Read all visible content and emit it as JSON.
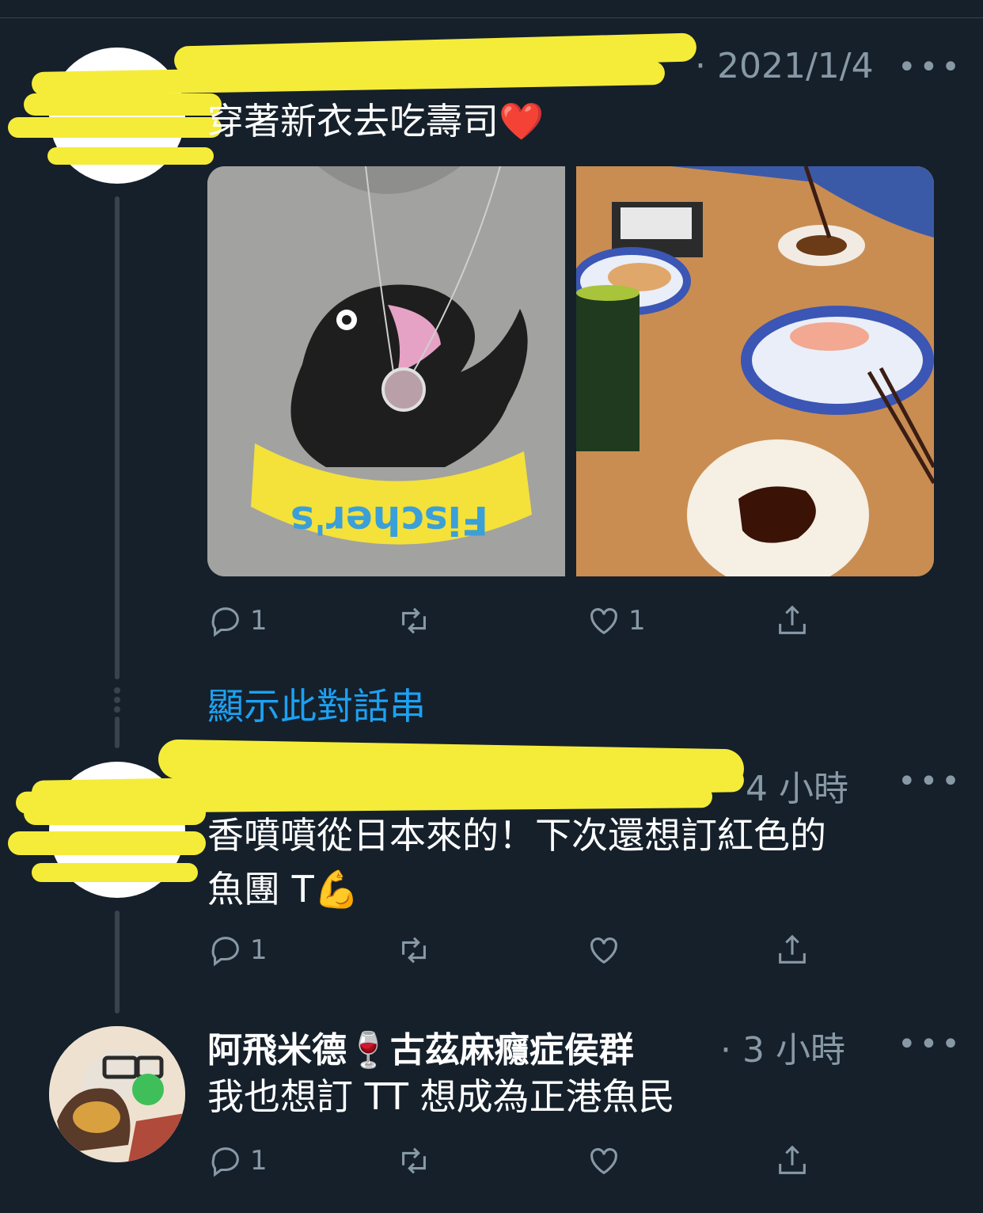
{
  "tweets": [
    {
      "date": "· 2021/1/4",
      "text": "穿著新衣去吃壽司❤️",
      "reply_count": "1",
      "like_count": "1",
      "show_thread": "顯示此對話串"
    },
    {
      "time": "4 小時",
      "text_line1": "香噴噴從日本來的！下次還想訂紅色的",
      "text_line2": "魚團 T💪",
      "reply_count": "1"
    },
    {
      "name": "阿飛米德🍷古茲麻癮症侯群",
      "time": "· 3 小時",
      "text": "我也想訂 TT 想成為正港魚民",
      "reply_count": "1"
    }
  ],
  "media": {
    "shirt_text": "Fischer's"
  },
  "more_glyph": "•••",
  "colors": {
    "background": "#15202b",
    "secondary_text": "#8899a6",
    "link": "#1da1f2",
    "redaction": "#f5ec3a"
  }
}
